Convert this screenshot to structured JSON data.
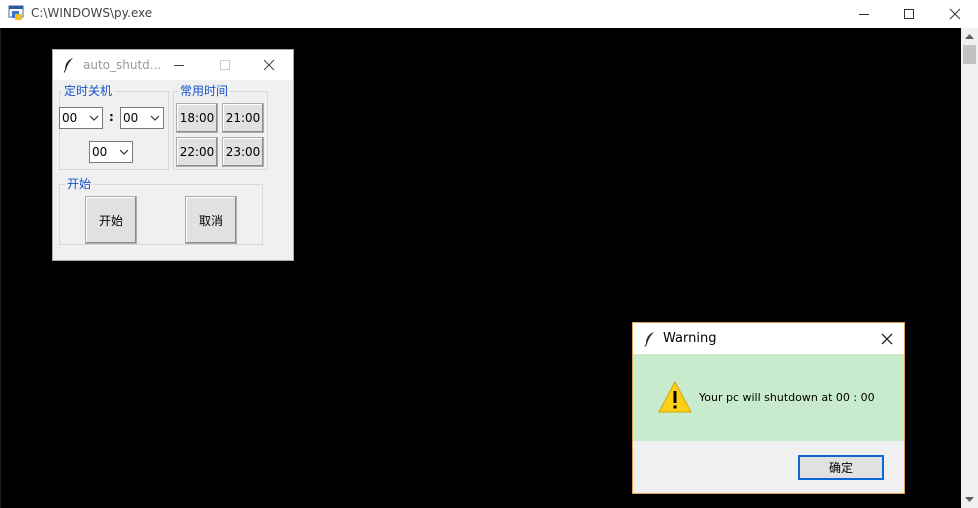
{
  "console": {
    "title": "C:\\WINDOWS\\py.exe",
    "minimize_icon": "minimize-icon",
    "maximize_icon": "maximize-icon",
    "close_icon": "close-icon"
  },
  "tk_window": {
    "title": "auto_shutd...",
    "icon": "feather-icon",
    "timer_group": {
      "label": "定时关机",
      "hour_value": "00",
      "minute_value": "00",
      "second_value": "00",
      "separator": ":"
    },
    "common_group": {
      "label": "常用时间",
      "times": [
        "18:00",
        "21:00",
        "22:00",
        "23:00"
      ]
    },
    "start_group": {
      "label": "开始",
      "start_button": "开始",
      "cancel_button": "取消"
    }
  },
  "dialog": {
    "title": "Warning",
    "message": "Your pc will shutdown at 00 : 00",
    "ok_button": "确定",
    "icon": "warning-icon"
  },
  "colors": {
    "group_label": "#1750c7",
    "dialog_content_bg": "#c8ebce",
    "dialog_border": "#e3a25a",
    "ok_border": "#0a6ad4"
  }
}
